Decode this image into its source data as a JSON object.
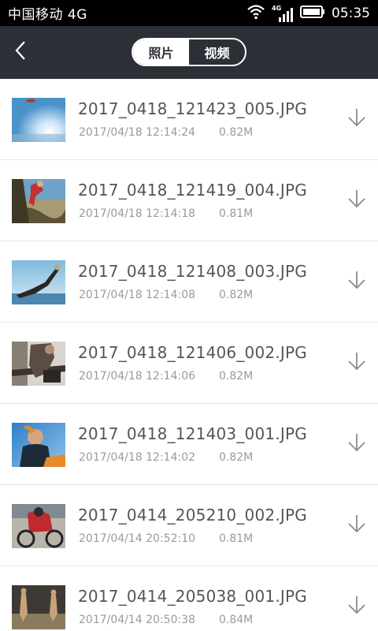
{
  "status_bar": {
    "carrier": "中国移动 4G",
    "network_tag": "4G",
    "time": "05:35"
  },
  "header": {
    "tabs": [
      {
        "label": "照片",
        "active": true
      },
      {
        "label": "视频",
        "active": false
      }
    ]
  },
  "files": [
    {
      "name": "2017_0418_121423_005.JPG",
      "date": "2017/04/18 12:14:24",
      "size": "0.82M"
    },
    {
      "name": "2017_0418_121419_004.JPG",
      "date": "2017/04/18 12:14:18",
      "size": "0.81M"
    },
    {
      "name": "2017_0418_121408_003.JPG",
      "date": "2017/04/18 12:14:08",
      "size": "0.82M"
    },
    {
      "name": "2017_0418_121406_002.JPG",
      "date": "2017/04/18 12:14:06",
      "size": "0.82M"
    },
    {
      "name": "2017_0418_121403_001.JPG",
      "date": "2017/04/18 12:14:02",
      "size": "0.82M"
    },
    {
      "name": "2017_0414_205210_002.JPG",
      "date": "2017/04/14 20:52:10",
      "size": "0.81M"
    },
    {
      "name": "2017_0414_205038_001.JPG",
      "date": "2017/04/14 20:50:38",
      "size": "0.84M"
    }
  ],
  "colors": {
    "header_bg": "#2b3036",
    "status_bg": "#000000",
    "filename": "#555555",
    "meta": "#9a9a9a",
    "divider": "#e6e6e6"
  }
}
